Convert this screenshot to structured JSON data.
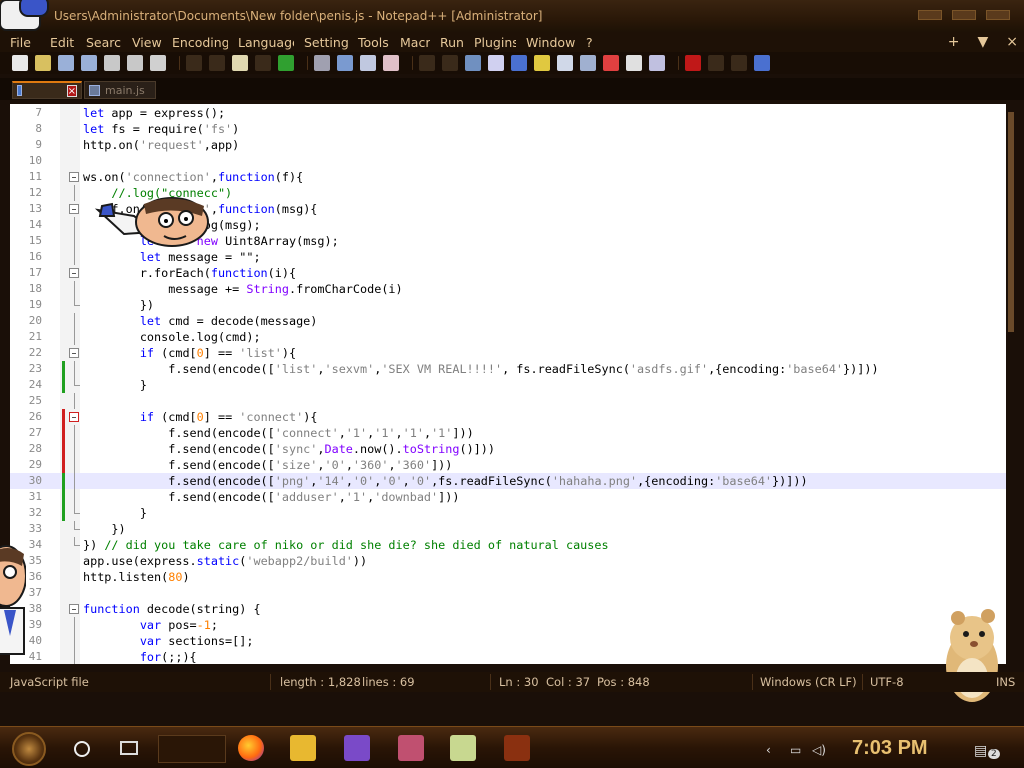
{
  "window": {
    "title": "Users\\Administrator\\Documents\\New folder\\penis.js - Notepad++ [Administrator]"
  },
  "menu": {
    "items": [
      "File",
      "Edit",
      "Search",
      "View",
      "Encoding",
      "Language",
      "Settings",
      "Tools",
      "Macro",
      "Run",
      "Plugins",
      "Window",
      "?"
    ],
    "right": [
      "+",
      "▼",
      "×"
    ]
  },
  "tabs": [
    {
      "label": "",
      "active": true
    },
    {
      "label": "main.js",
      "active": false
    }
  ],
  "editor": {
    "current_line": 30,
    "lines": [
      {
        "n": "7",
        "html": "<span class=\"kw\">let</span> app = express();"
      },
      {
        "n": "8",
        "html": "<span class=\"kw\">let</span> fs = require(<span class=\"str\">'fs'</span>)"
      },
      {
        "n": "9",
        "html": "http.on(<span class=\"str\">'request'</span>,app)"
      },
      {
        "n": "10",
        "html": ""
      },
      {
        "n": "11",
        "html": "ws.on(<span class=\"str\">'connection'</span>,<span class=\"kw\">function</span>(f){"
      },
      {
        "n": "12",
        "html": "    <span class=\"cm\">//.log(\"connecc\")</span>"
      },
      {
        "n": "13",
        "html": "    f.on(<span class=\"str\">'message'</span>,<span class=\"kw\">function</span>(msg){"
      },
      {
        "n": "14",
        "html": "        console.log(msg);"
      },
      {
        "n": "15",
        "html": "        <span class=\"kw\">let</span> r = <span class=\"obj\">new</span> Uint8Array(msg);"
      },
      {
        "n": "16",
        "html": "        <span class=\"kw\">let</span> message = \"\";"
      },
      {
        "n": "17",
        "html": "        r.forEach(<span class=\"kw\">function</span>(i){"
      },
      {
        "n": "18",
        "html": "            message += <span class=\"obj\">String</span>.fromCharCode(i)"
      },
      {
        "n": "19",
        "html": "        })"
      },
      {
        "n": "20",
        "html": "        <span class=\"kw\">let</span> cmd = decode(message)"
      },
      {
        "n": "21",
        "html": "        console.log(cmd);"
      },
      {
        "n": "22",
        "html": "        <span class=\"kw\">if</span> (cmd[<span class=\"num\">0</span>] == <span class=\"str\">'list'</span>){"
      },
      {
        "n": "23",
        "html": "            f.send(encode([<span class=\"str\">'list'</span>,<span class=\"str\">'sexvm'</span>,<span class=\"str\">'SEX VM REAL!!!!'</span>, fs.readFileSync(<span class=\"str\">'asdfs.gif'</span>,{encoding:<span class=\"str\">'base64'</span>})]))"
      },
      {
        "n": "24",
        "html": "        }"
      },
      {
        "n": "25",
        "html": ""
      },
      {
        "n": "26",
        "html": "        <span class=\"kw\">if</span> (cmd[<span class=\"num\">0</span>] == <span class=\"str\">'connect'</span>){"
      },
      {
        "n": "27",
        "html": "            f.send(encode([<span class=\"str\">'connect'</span>,<span class=\"str\">'1'</span>,<span class=\"str\">'1'</span>,<span class=\"str\">'1'</span>,<span class=\"str\">'1'</span>]))"
      },
      {
        "n": "28",
        "html": "            f.send(encode([<span class=\"str\">'sync'</span>,<span class=\"obj\">Date</span>.now().<span class=\"obj\">toString</span>()]))"
      },
      {
        "n": "29",
        "html": "            f.send(encode([<span class=\"str\">'size'</span>,<span class=\"str\">'0'</span>,<span class=\"str\">'360'</span>,<span class=\"str\">'360'</span>]))"
      },
      {
        "n": "30",
        "html": "            f.send(encode([<span class=\"str\">'png'</span>,<span class=\"str\">'14'</span>,<span class=\"str\">'0'</span>,<span class=\"str\">'0'</span>,<span class=\"str\">'0'</span>,fs.readFileSync(<span class=\"str\">'hahaha.png'</span>,{encoding:<span class=\"str\">'base64'</span>})]))"
      },
      {
        "n": "31",
        "html": "            f.send(encode([<span class=\"str\">'adduser'</span>,<span class=\"str\">'1'</span>,<span class=\"str\">'downbad'</span>]))"
      },
      {
        "n": "32",
        "html": "        }"
      },
      {
        "n": "33",
        "html": "    })"
      },
      {
        "n": "34",
        "html": "}) <span class=\"cm\">// did you take care of niko or did she die? she died of natural causes</span>"
      },
      {
        "n": "35",
        "html": "app.use(express.<span class=\"kw\">static</span>(<span class=\"str\">'webapp2/build'</span>))"
      },
      {
        "n": "36",
        "html": "http.listen(<span class=\"num\">80</span>)"
      },
      {
        "n": "37",
        "html": ""
      },
      {
        "n": "38",
        "html": "<span class=\"kw\">function</span> decode(string) {"
      },
      {
        "n": "39",
        "html": "        <span class=\"kw\">var</span> pos=<span class=\"num\">-1</span>;"
      },
      {
        "n": "40",
        "html": "        <span class=\"kw\">var</span> sections=[];"
      },
      {
        "n": "41",
        "html": "        <span class=\"kw\">for</span>(;;){"
      }
    ]
  },
  "status": {
    "filetype": "JavaScript file",
    "length": "length : 1,828",
    "lines": "lines : 69",
    "ln": "Ln : 30",
    "col": "Col : 37",
    "pos": "Pos : 848",
    "eol": "Windows (CR LF)",
    "encoding": "UTF-8",
    "ins": "INS"
  },
  "taskbar": {
    "clock": "7:03 PM",
    "notifications": "2"
  }
}
